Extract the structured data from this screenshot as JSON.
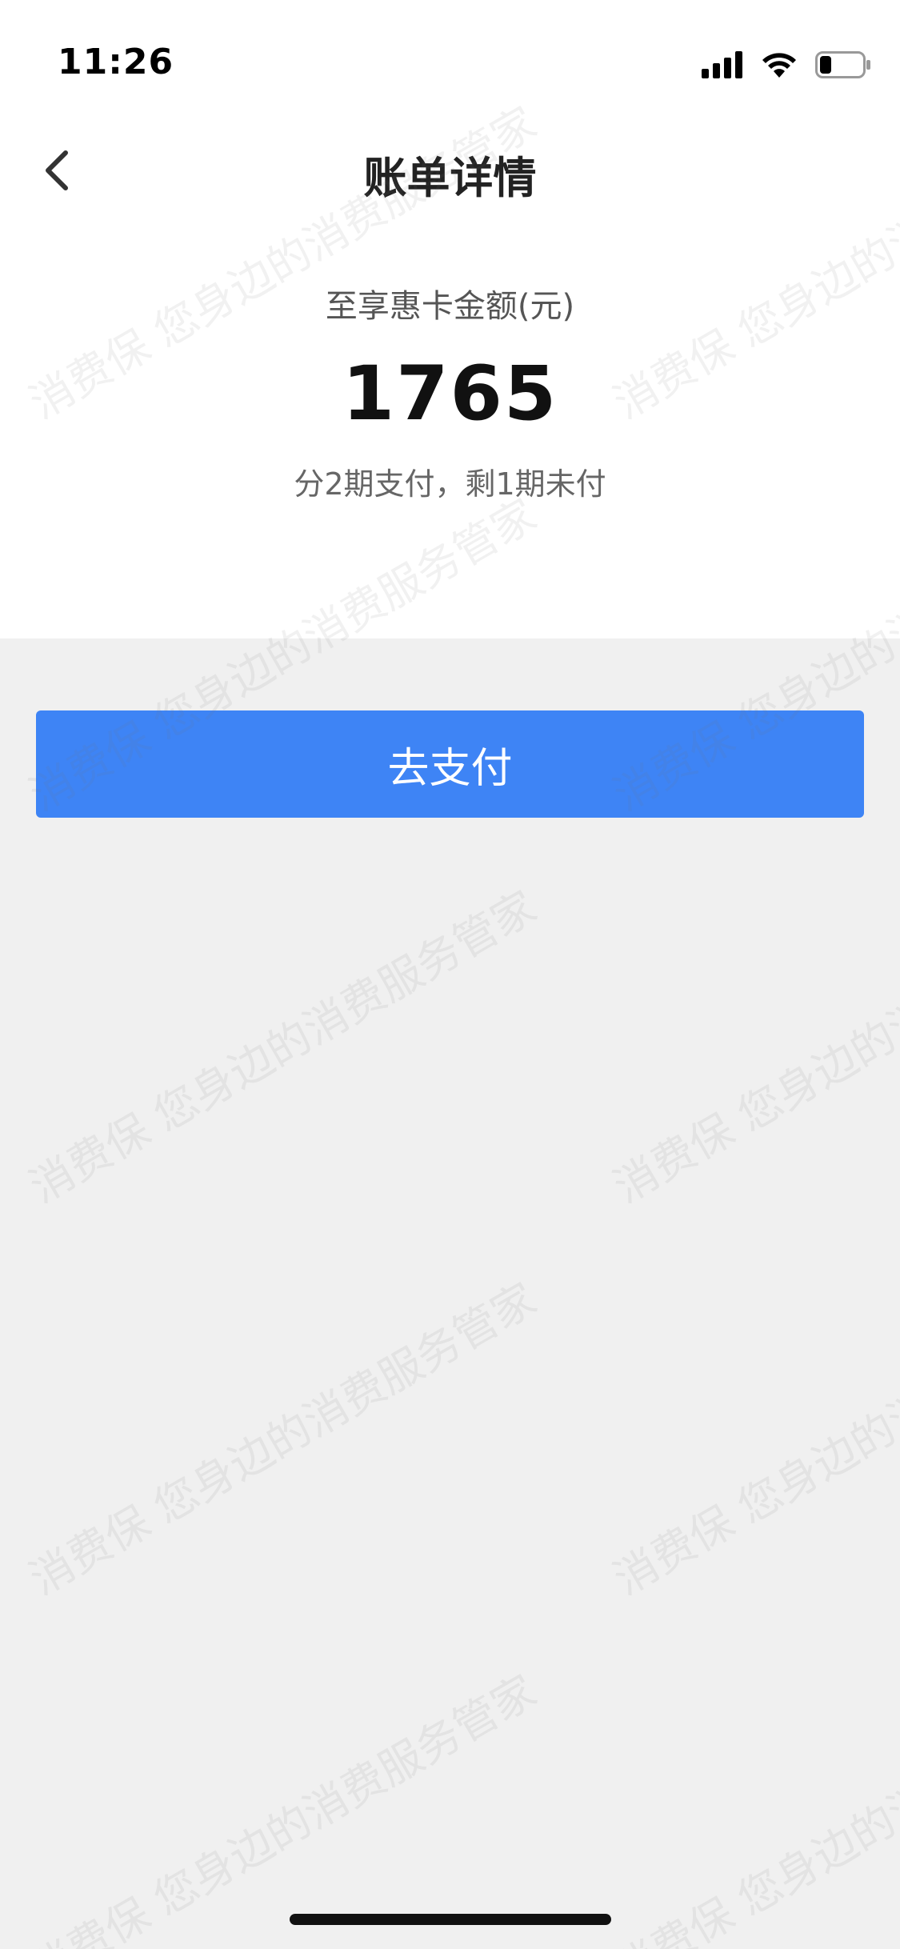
{
  "status_bar": {
    "time": "11:26",
    "icons": [
      "signal-icon",
      "wifi-icon",
      "battery-icon"
    ]
  },
  "nav": {
    "title": "账单详情",
    "back_icon": "chevron-left-icon"
  },
  "summary": {
    "label": "至享惠卡金额(元)",
    "amount": "1765",
    "installment_info": "分2期支付，剩1期未付"
  },
  "actions": {
    "pay_label": "去支付"
  },
  "watermark": {
    "text": "消费保 您身边的消费服务管家"
  },
  "colors": {
    "accent": "#3e84f5",
    "page_bg": "#f0f0f0",
    "card_bg": "#ffffff"
  }
}
